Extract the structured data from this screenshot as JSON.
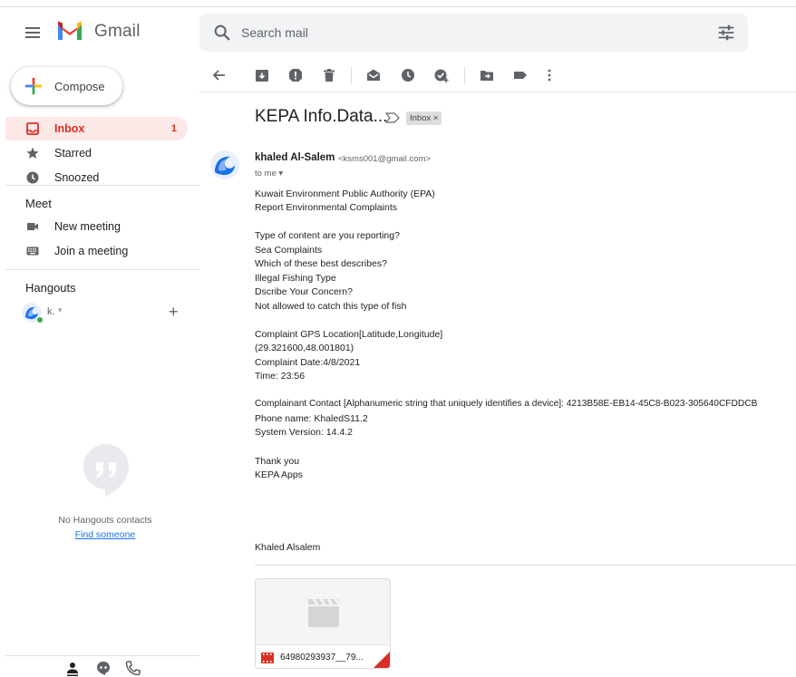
{
  "app": {
    "name": "Gmail"
  },
  "search": {
    "placeholder": "Search mail"
  },
  "compose": {
    "label": "Compose"
  },
  "nav": {
    "items": [
      {
        "label": "Inbox",
        "count": "1"
      },
      {
        "label": "Starred"
      },
      {
        "label": "Snoozed"
      }
    ]
  },
  "meet": {
    "title": "Meet",
    "items": [
      {
        "label": "New meeting"
      },
      {
        "label": "Join a meeting"
      }
    ]
  },
  "hangouts": {
    "title": "Hangouts",
    "user": "k.",
    "empty_text": "No Hangouts contacts",
    "find_link": "Find someone"
  },
  "message": {
    "subject": "KEPA Info.Data...",
    "label": "Inbox ×",
    "sender_name": "khaled Al-Salem",
    "sender_email": "<ksms001@gmail.com>",
    "to": "to me ▾",
    "body": [
      "Kuwait Environment Public Authority (EPA)",
      "Report Environmental Complaints",
      "",
      "Type of content are you reporting?",
      "Sea Complaints",
      "Which of these best describes?",
      "Illegal Fishing Type",
      "Dscribe Your Concern?",
      "Not allowed to catch this type of fish",
      "",
      "Complaint GPS Location[Latitude,Longitude]",
      "(29.321600,48.001801)",
      "Complaint Date:4/8/2021",
      "Time: 23:56",
      "",
      "Complainant Contact [Alphanumeric string that uniquely identifies a device]: 4213B58E-EB14-45C8-B023-305640CFDDCB",
      "Phone name: KhaledS11.2",
      "System Version: 14.4.2",
      "",
      "Thank you",
      "KEPA Apps"
    ],
    "signature": "Khaled Alsalem",
    "attachment_name": "64980293937__79..."
  },
  "colors": {
    "accent_red": "#d93025",
    "inbox_bg": "#fce8e6",
    "search_bg": "#f1f3f4",
    "link_blue": "#1a73e8"
  }
}
